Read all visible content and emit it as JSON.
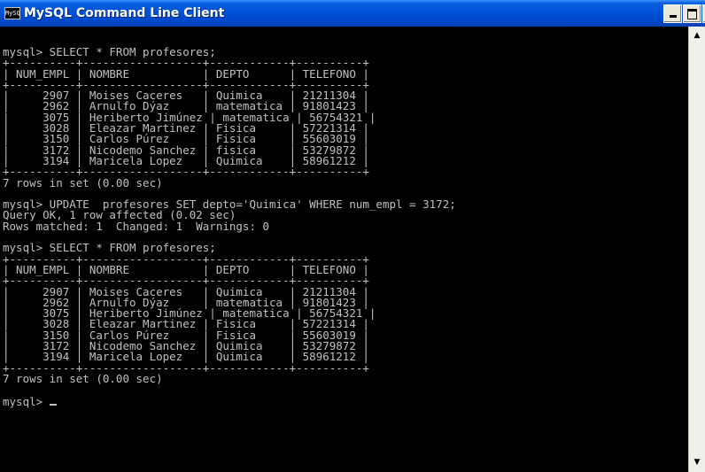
{
  "window": {
    "title": "MySQL Command Line Client",
    "app_icon_text": "MySQL",
    "close_glyph": "×"
  },
  "console": {
    "lines": [
      "mysql> SELECT * FROM profesores;",
      "+----------+------------------+------------+----------+",
      "| NUM_EMPL | NOMBRE           | DEPTO      | TELEFONO |",
      "+----------+------------------+------------+----------+",
      "|     2907 | Moises Caceres   | Quimica    | 21211304 |",
      "|     2962 | Arnulfo Dýaz     | matematica | 91801423 |",
      "|     3075 | Heriberto Jimúnez | matematica | 56754321 |",
      "|     3028 | Eleazar Martinez | Fisica     | 57221314 |",
      "|     3150 | Carlos Púrez     | Fisica     | 55603019 |",
      "|     3172 | Nicodemo Sanchez | fisica     | 53279872 |",
      "|     3194 | Maricela Lopez   | Quimica    | 58961212 |",
      "+----------+------------------+------------+----------+",
      "7 rows in set (0.00 sec)",
      "",
      "mysql> UPDATE  profesores SET depto='Quimica' WHERE num_empl = 3172;",
      "Query OK, 1 row affected (0.02 sec)",
      "Rows matched: 1  Changed: 1  Warnings: 0",
      "",
      "mysql> SELECT * FROM profesores;",
      "+----------+------------------+------------+----------+",
      "| NUM_EMPL | NOMBRE           | DEPTO      | TELEFONO |",
      "+----------+------------------+------------+----------+",
      "|     2907 | Moises Caceres   | Quimica    | 21211304 |",
      "|     2962 | Arnulfo Dýaz     | matematica | 91801423 |",
      "|     3075 | Heriberto Jimúnez | matematica | 56754321 |",
      "|     3028 | Eleazar Martinez | Fisica     | 57221314 |",
      "|     3150 | Carlos Púrez     | Fisica     | 55603019 |",
      "|     3172 | Nicodemo Sanchez | Quimica    | 53279872 |",
      "|     3194 | Maricela Lopez   | Quimica    | 58961212 |",
      "+----------+------------------+------------+----------+",
      "7 rows in set (0.00 sec)",
      ""
    ],
    "prompt": "mysql> "
  },
  "colors": {
    "console_bg": "#000000",
    "console_fg": "#c0c0c0",
    "titlebar": "#0052d9"
  },
  "icons": {
    "app": "console-icon",
    "minimize": "minimize-icon",
    "maximize": "maximize-icon",
    "close": "close-icon",
    "scroll_up": "up-arrow-icon",
    "scroll_down": "down-arrow-icon"
  }
}
